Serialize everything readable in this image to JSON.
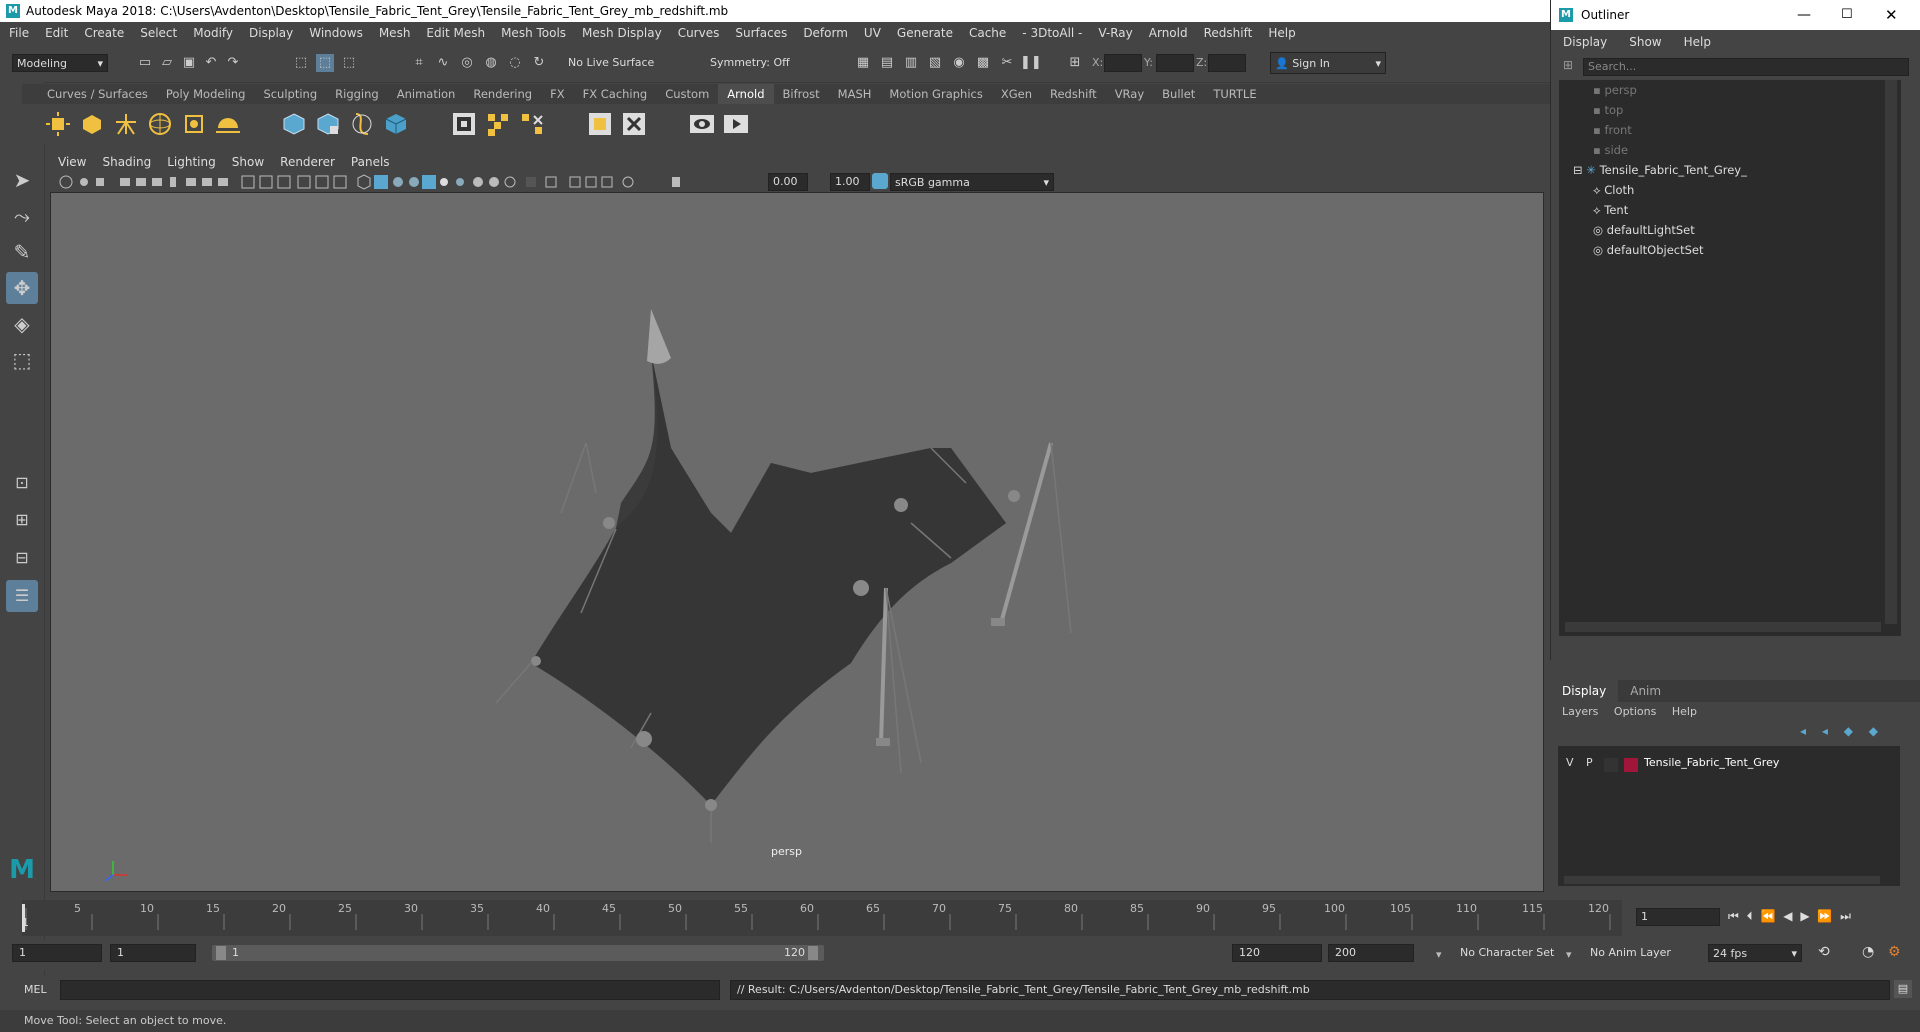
{
  "window": {
    "title": "Autodesk Maya 2018: C:\\Users\\Avdenton\\Desktop\\Tensile_Fabric_Tent_Grey\\Tensile_Fabric_Tent_Grey_mb_redshift.mb"
  },
  "menubar": [
    "File",
    "Edit",
    "Create",
    "Select",
    "Modify",
    "Display",
    "Windows",
    "Mesh",
    "Edit Mesh",
    "Mesh Tools",
    "Mesh Display",
    "Curves",
    "Surfaces",
    "Deform",
    "UV",
    "Generate",
    "Cache",
    "- 3DtoAll -",
    "V-Ray",
    "Arnold",
    "Redshift",
    "Help"
  ],
  "statusline": {
    "mode": "Modeling",
    "live_surface": "No Live Surface",
    "symmetry": "Symmetry: Off",
    "x_label": "X:",
    "y_label": "Y:",
    "z_label": "Z:",
    "sign_in": "Sign In"
  },
  "shelf": {
    "tabs": [
      "Curves / Surfaces",
      "Poly Modeling",
      "Sculpting",
      "Rigging",
      "Animation",
      "Rendering",
      "FX",
      "FX Caching",
      "Custom",
      "Arnold",
      "Bifrost",
      "MASH",
      "Motion Graphics",
      "XGen",
      "Redshift",
      "VRay",
      "Bullet",
      "TURTLE"
    ],
    "active": "Arnold"
  },
  "viewport": {
    "menu": [
      "View",
      "Shading",
      "Lighting",
      "Show",
      "Renderer",
      "Panels"
    ],
    "exposure": "0.00",
    "gamma": "1.00",
    "color_space": "sRGB gamma",
    "camera_label": "persp"
  },
  "outliner": {
    "title": "Outliner",
    "menu": [
      "Display",
      "Show",
      "Help"
    ],
    "search_placeholder": "Search...",
    "items": [
      {
        "label": "persp",
        "dim": true
      },
      {
        "label": "top",
        "dim": true
      },
      {
        "label": "front",
        "dim": true
      },
      {
        "label": "side",
        "dim": true
      },
      {
        "label": "Tensile_Fabric_Tent_Grey_",
        "dim": false
      },
      {
        "label": "Cloth",
        "dim": false
      },
      {
        "label": "Tent",
        "dim": false
      },
      {
        "label": "defaultLightSet",
        "dim": false
      },
      {
        "label": "defaultObjectSet",
        "dim": false
      }
    ]
  },
  "layer_editor": {
    "tabs": [
      "Display",
      "Anim"
    ],
    "active_tab": "Display",
    "menu": [
      "Layers",
      "Options",
      "Help"
    ],
    "layer": {
      "v": "V",
      "p": "P",
      "name": "Tensile_Fabric_Tent_Grey",
      "color": "#a0163a"
    }
  },
  "timeline": {
    "ticks": [
      "5",
      "10",
      "15",
      "20",
      "25",
      "30",
      "35",
      "40",
      "45",
      "50",
      "55",
      "60",
      "65",
      "70",
      "75",
      "80",
      "85",
      "90",
      "95",
      "100",
      "105",
      "110",
      "115",
      "120"
    ],
    "start_tick": "1",
    "current_frame": "1"
  },
  "range": {
    "start": "1",
    "playback_start": "1",
    "slider_start": "1",
    "slider_end": "120",
    "playback_end": "120",
    "end": "200",
    "character_set": "No Character Set",
    "anim_layer": "No Anim Layer",
    "fps": "24 fps"
  },
  "command": {
    "mel_label": "MEL",
    "result": "// Result: C:/Users/Avdenton/Desktop/Tensile_Fabric_Tent_Grey/Tensile_Fabric_Tent_Grey_mb_redshift.mb"
  },
  "help_line": "Move Tool: Select an object to move."
}
